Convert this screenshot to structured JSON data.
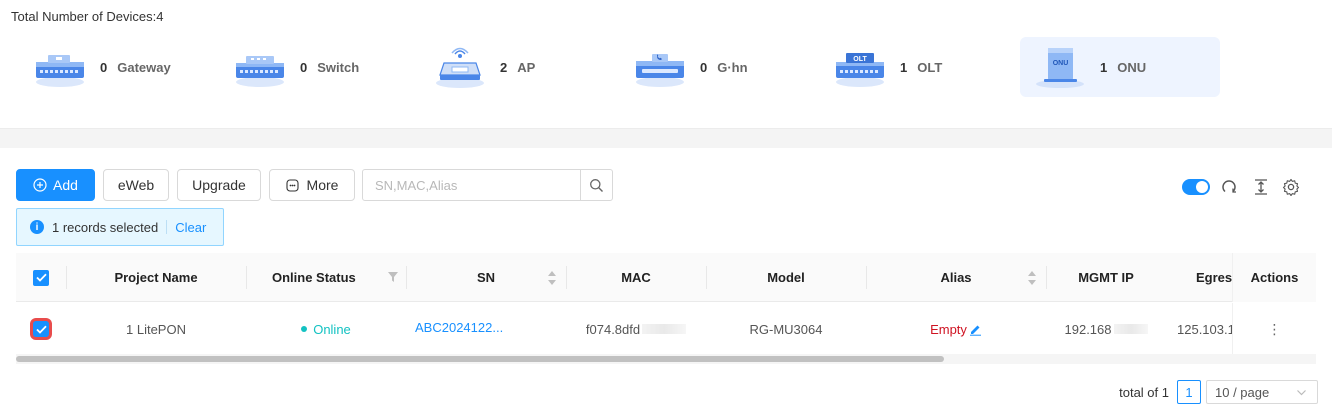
{
  "summary": {
    "total_label": "Total Number of Devices:4"
  },
  "device_types": [
    {
      "count": "0",
      "name": "Gateway",
      "icon": "gateway-device-icon",
      "active": false
    },
    {
      "count": "0",
      "name": "Switch",
      "icon": "switch-device-icon",
      "active": false
    },
    {
      "count": "2",
      "name": "AP",
      "icon": "ap-device-icon",
      "active": false
    },
    {
      "count": "0",
      "name": "G·hn",
      "icon": "ghn-device-icon",
      "active": false
    },
    {
      "count": "1",
      "name": "OLT",
      "icon": "olt-device-icon",
      "device_label": "OLT",
      "active": false
    },
    {
      "count": "1",
      "name": "ONU",
      "icon": "onu-device-icon",
      "device_label": "ONU",
      "active": true
    }
  ],
  "toolbar": {
    "add_label": "Add",
    "eweb_label": "eWeb",
    "upgrade_label": "Upgrade",
    "more_label": "More",
    "search_placeholder": "SN,MAC,Alias"
  },
  "selection": {
    "text": "1 records selected",
    "clear_label": "Clear"
  },
  "table": {
    "columns": [
      "Project Name",
      "Online Status",
      "SN",
      "MAC",
      "Model",
      "Alias",
      "MGMT IP",
      "Egres",
      "Actions"
    ],
    "rows": [
      {
        "selected": true,
        "project_name": "1 LitePON",
        "online_status": "Online",
        "sn": "ABC2024122...",
        "mac": "f074.8dfd",
        "model": "RG-MU3064",
        "alias": "Empty",
        "mgmt_ip": "192.168",
        "egress": "125.103.1",
        "actions_icon": "⋮"
      }
    ]
  },
  "pagination": {
    "total_label": "total of 1",
    "current_page": "1",
    "page_size": "10 / page"
  },
  "colors": {
    "accent": "#1890ff",
    "online": "#13c2c2",
    "empty_alias": "#cf1322",
    "selected_card": "#eef4ff"
  }
}
